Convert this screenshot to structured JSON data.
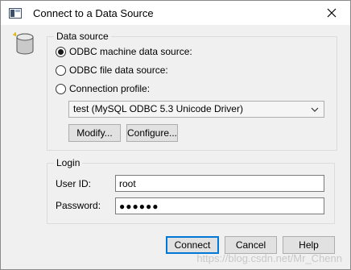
{
  "window": {
    "title": "Connect to a Data Source",
    "close_icon": "close-icon"
  },
  "data_source": {
    "group_label": "Data source",
    "options": [
      {
        "label": "ODBC machine data source:",
        "checked": true
      },
      {
        "label": "ODBC file data source:",
        "checked": false
      },
      {
        "label": "Connection profile:",
        "checked": false
      }
    ],
    "selected_profile": "test (MySQL ODBC 5.3 Unicode Driver)",
    "modify_label": "Modify...",
    "configure_label": "Configure..."
  },
  "login": {
    "group_label": "Login",
    "user_id_label": "User ID:",
    "user_id_value": "root",
    "password_label": "Password:",
    "password_value": "●●●●●●"
  },
  "footer": {
    "connect_label": "Connect",
    "cancel_label": "Cancel",
    "help_label": "Help"
  },
  "watermark": "https://blog.csdn.net/Mr_Chenn"
}
